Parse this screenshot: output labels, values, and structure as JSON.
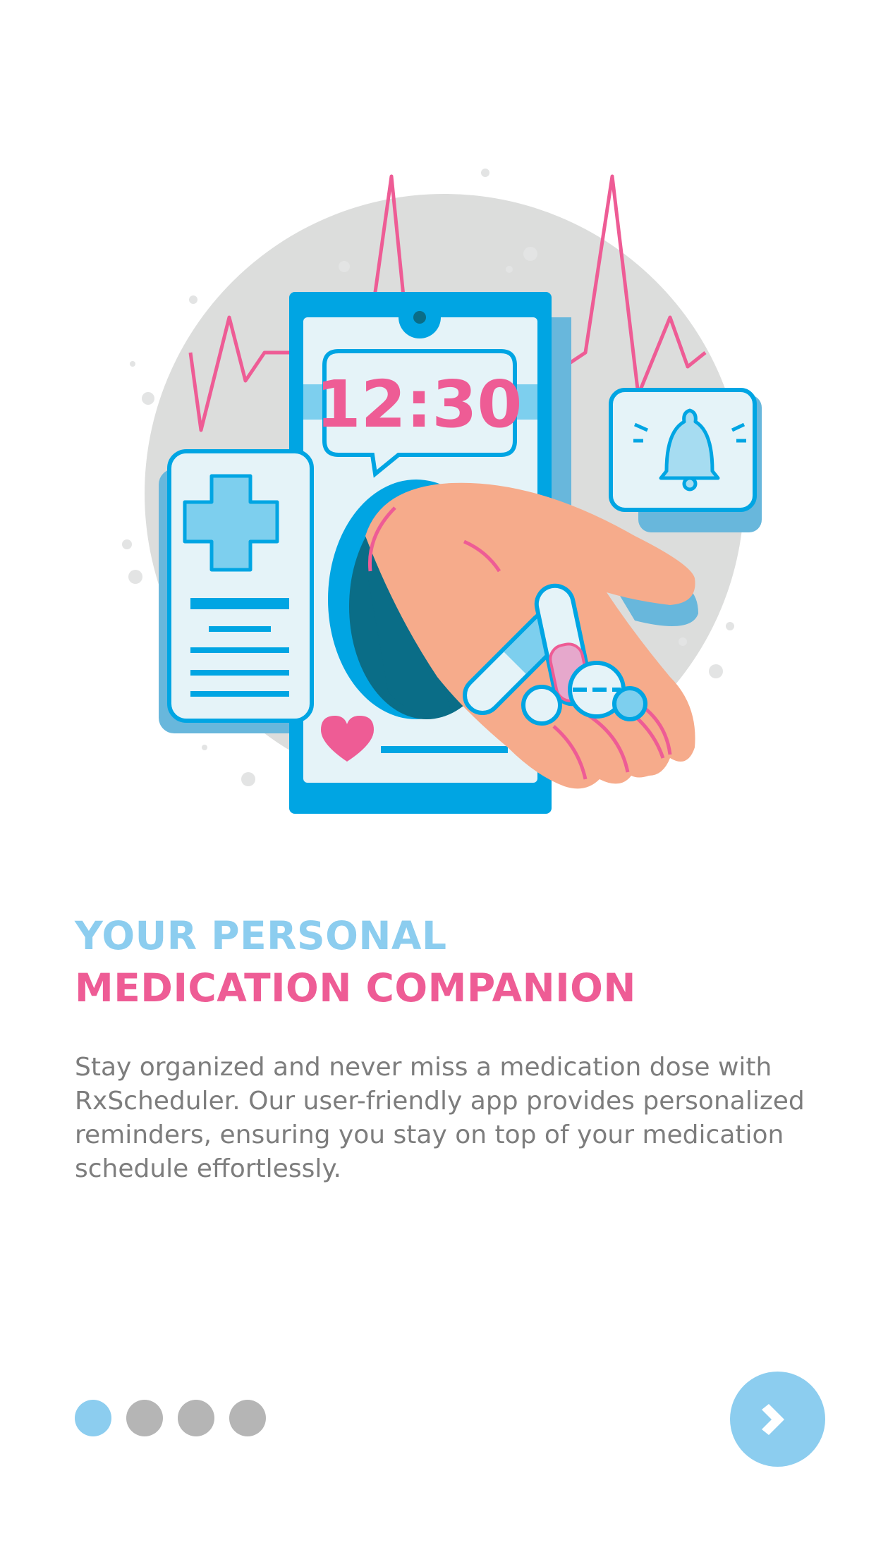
{
  "illustration": {
    "clock_time": "12:30",
    "icons": [
      "phone-icon",
      "medical-card-icon",
      "bell-icon",
      "heart-icon",
      "hand-with-pills-icon"
    ]
  },
  "headline": {
    "line1": "YOUR PERSONAL",
    "line2": "MEDICATION COMPANION"
  },
  "description": "Stay organized and never miss a medication dose with RxScheduler. Our user-friendly app provides personalized reminders, ensuring you stay on top of your medication schedule effortlessly.",
  "pager": {
    "total": 4,
    "active_index": 0
  },
  "next_button": {
    "icon": "chevron-right-icon"
  },
  "colors": {
    "accent_blue": "#8ccdef",
    "accent_pink": "#ee5c95",
    "text_gray": "#7d7d7d",
    "dot_inactive": "#b5b5b5",
    "phone_blue": "#00a5e3"
  }
}
